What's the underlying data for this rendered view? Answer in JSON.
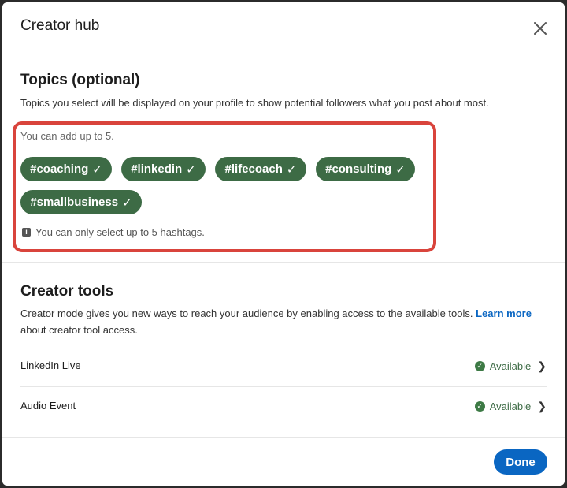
{
  "header": {
    "title": "Creator hub",
    "close_icon": "close-icon"
  },
  "topics": {
    "title": "Topics (optional)",
    "description": "Topics you select will be displayed on your profile to show potential followers what you post about most.",
    "hint": "You can add up to 5.",
    "chips": [
      {
        "label": "#coaching",
        "check": "✓"
      },
      {
        "label": "#linkedin",
        "check": "✓"
      },
      {
        "label": "#lifecoach",
        "check": "✓"
      },
      {
        "label": "#consulting",
        "check": "✓"
      },
      {
        "label": "#smallbusiness",
        "check": "✓"
      }
    ],
    "note": "You can only select up to 5 hashtags.",
    "note_icon": "info-icon"
  },
  "creator_tools": {
    "title": "Creator tools",
    "description_part1": "Creator mode gives you new ways to reach your audience by enabling access to the available tools.",
    "learn_more": "Learn more",
    "description_part2": "about creator tool access.",
    "items": [
      {
        "label": "LinkedIn Live",
        "status": "Available",
        "status_icon": "check-circle-icon"
      },
      {
        "label": "Audio Event",
        "status": "Available",
        "status_icon": "check-circle-icon"
      }
    ]
  },
  "footer": {
    "done_label": "Done"
  },
  "colors": {
    "accent": "#0a66c2",
    "chip": "#3d6b45",
    "highlight": "#d9443c"
  }
}
